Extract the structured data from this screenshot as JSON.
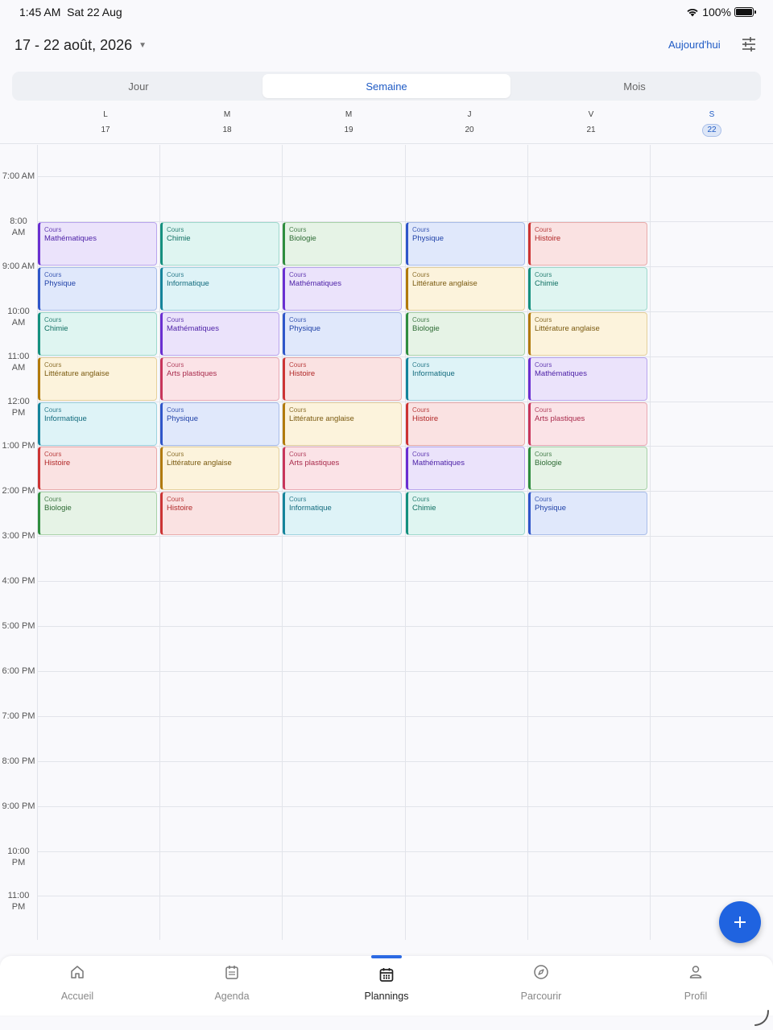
{
  "status_bar": {
    "time": "1:45 AM",
    "date": "Sat 22 Aug",
    "battery": "100%",
    "battery_level": 1.0
  },
  "header": {
    "date_range": "17 - 22 août, 2026",
    "today_label": "Aujourd'hui"
  },
  "view_tabs": [
    {
      "label": "Jour",
      "active": false
    },
    {
      "label": "Semaine",
      "active": true
    },
    {
      "label": "Mois",
      "active": false
    }
  ],
  "days": [
    {
      "letter": "L",
      "num": "17",
      "today": false
    },
    {
      "letter": "M",
      "num": "18",
      "today": false
    },
    {
      "letter": "M",
      "num": "19",
      "today": false
    },
    {
      "letter": "J",
      "num": "20",
      "today": false
    },
    {
      "letter": "V",
      "num": "21",
      "today": false
    },
    {
      "letter": "S",
      "num": "22",
      "today": true
    }
  ],
  "time_labels": [
    [
      "7:00 AM"
    ],
    [
      "8:00",
      "AM"
    ],
    [
      "9:00 AM"
    ],
    [
      "10:00",
      "AM"
    ],
    [
      "11:00",
      "AM"
    ],
    [
      "12:00",
      "PM"
    ],
    [
      "1:00 PM"
    ],
    [
      "2:00 PM"
    ],
    [
      "3:00 PM"
    ],
    [
      "4:00 PM"
    ],
    [
      "5:00 PM"
    ],
    [
      "6:00 PM"
    ],
    [
      "7:00 PM"
    ],
    [
      "8:00 PM"
    ],
    [
      "9:00 PM"
    ],
    [
      "10:00",
      "PM"
    ],
    [
      "11:00",
      "PM"
    ]
  ],
  "subject_colors": {
    "Mathématiques": {
      "bg": "#ebe3fb",
      "border": "#b9a5ee",
      "bar": "#6a2fd1",
      "text": "#4b1fa6"
    },
    "Physique": {
      "bg": "#e0e8fb",
      "border": "#a9bde9",
      "bar": "#2f56c9",
      "text": "#2042a8"
    },
    "Chimie": {
      "bg": "#dff5f1",
      "border": "#9fd9cd",
      "bar": "#15907e",
      "text": "#0f6f62"
    },
    "Littérature anglaise": {
      "bg": "#fcf3dc",
      "border": "#e5d09c",
      "bar": "#b17a0c",
      "text": "#7a5a10"
    },
    "Informatique": {
      "bg": "#def3f7",
      "border": "#9fd3df",
      "bar": "#15849b",
      "text": "#116a7d"
    },
    "Histoire": {
      "bg": "#fae2e2",
      "border": "#e9abab",
      "bar": "#cc3434",
      "text": "#b02626"
    },
    "Biologie": {
      "bg": "#e6f3e6",
      "border": "#a9d2a9",
      "bar": "#2f8d3f",
      "text": "#2d6b34"
    },
    "Arts plastiques": {
      "bg": "#fbe3e7",
      "border": "#e9aab4",
      "bar": "#c8355b",
      "text": "#a82a4b"
    }
  },
  "event_type_label": "Cours",
  "schedule": [
    [
      "Mathématiques",
      "Physique",
      "Chimie",
      "Littérature anglaise",
      "Informatique",
      "Histoire",
      "Biologie"
    ],
    [
      "Chimie",
      "Informatique",
      "Mathématiques",
      "Arts plastiques",
      "Physique",
      "Littérature anglaise",
      "Histoire"
    ],
    [
      "Biologie",
      "Mathématiques",
      "Physique",
      "Histoire",
      "Littérature anglaise",
      "Arts plastiques",
      "Informatique"
    ],
    [
      "Physique",
      "Littérature anglaise",
      "Biologie",
      "Informatique",
      "Histoire",
      "Mathématiques",
      "Chimie"
    ],
    [
      "Histoire",
      "Chimie",
      "Littérature anglaise",
      "Mathématiques",
      "Arts plastiques",
      "Biologie",
      "Physique"
    ]
  ],
  "schedule_start_hour": "8:00 AM",
  "fab": {
    "icon": "plus-icon"
  },
  "bottom_nav": [
    {
      "label": "Accueil",
      "icon": "home-icon",
      "active": false
    },
    {
      "label": "Agenda",
      "icon": "agenda-icon",
      "active": false
    },
    {
      "label": "Plannings",
      "icon": "calendar-icon",
      "active": true
    },
    {
      "label": "Parcourir",
      "icon": "compass-icon",
      "active": false
    },
    {
      "label": "Profil",
      "icon": "user-icon",
      "active": false
    }
  ]
}
